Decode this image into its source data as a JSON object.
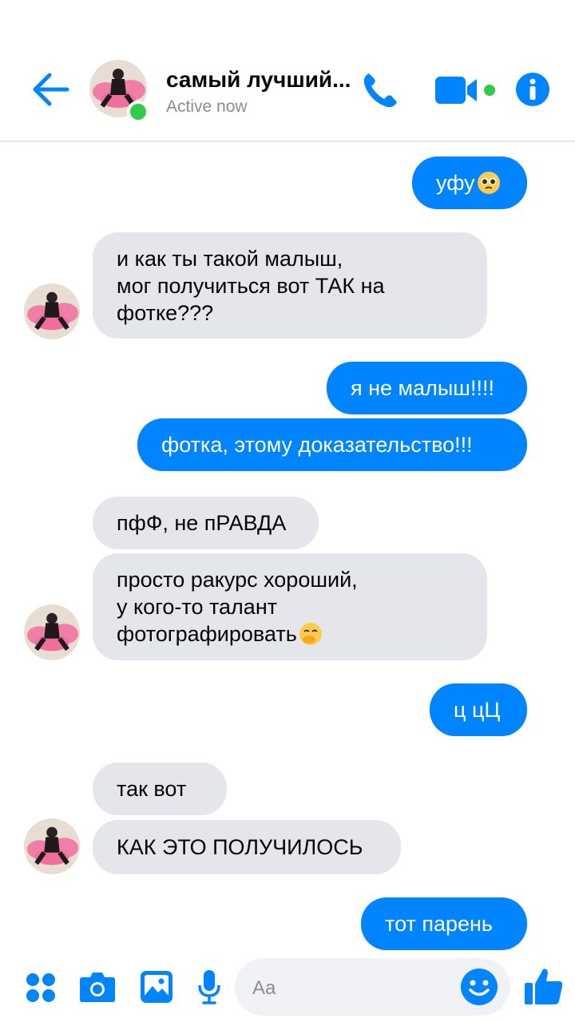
{
  "header": {
    "title": "самый лучший...",
    "status": "Active now"
  },
  "messages": [
    {
      "dir": "out",
      "text": "уфу",
      "emoji": "pleading-face"
    },
    {
      "dir": "in",
      "lines": [
        "и как ты такой малыш,",
        "мог получиться вот ТАК на",
        "фотке???"
      ]
    },
    {
      "dir": "out",
      "text": "я не малыш!!!!"
    },
    {
      "dir": "out",
      "text": "фотка, этому доказательство!!!"
    },
    {
      "dir": "in",
      "text": "пфФ, не пРАВДА"
    },
    {
      "dir": "in",
      "lines": [
        "просто ракурс хороший,",
        "у кого-то талант",
        "фотографировать"
      ],
      "emoji": "hand-over-mouth"
    },
    {
      "dir": "out",
      "text": "ц цЦ"
    },
    {
      "dir": "in",
      "text": "так вот"
    },
    {
      "dir": "in",
      "text": "КАК ЭТО ПОЛУЧИЛОСЬ"
    },
    {
      "dir": "out",
      "text": "тот парень"
    }
  ],
  "composer": {
    "placeholder": "Aa"
  },
  "colors": {
    "accent": "#0084ff",
    "incoming_bubble": "#e4e6eb",
    "online": "#31cc46"
  }
}
